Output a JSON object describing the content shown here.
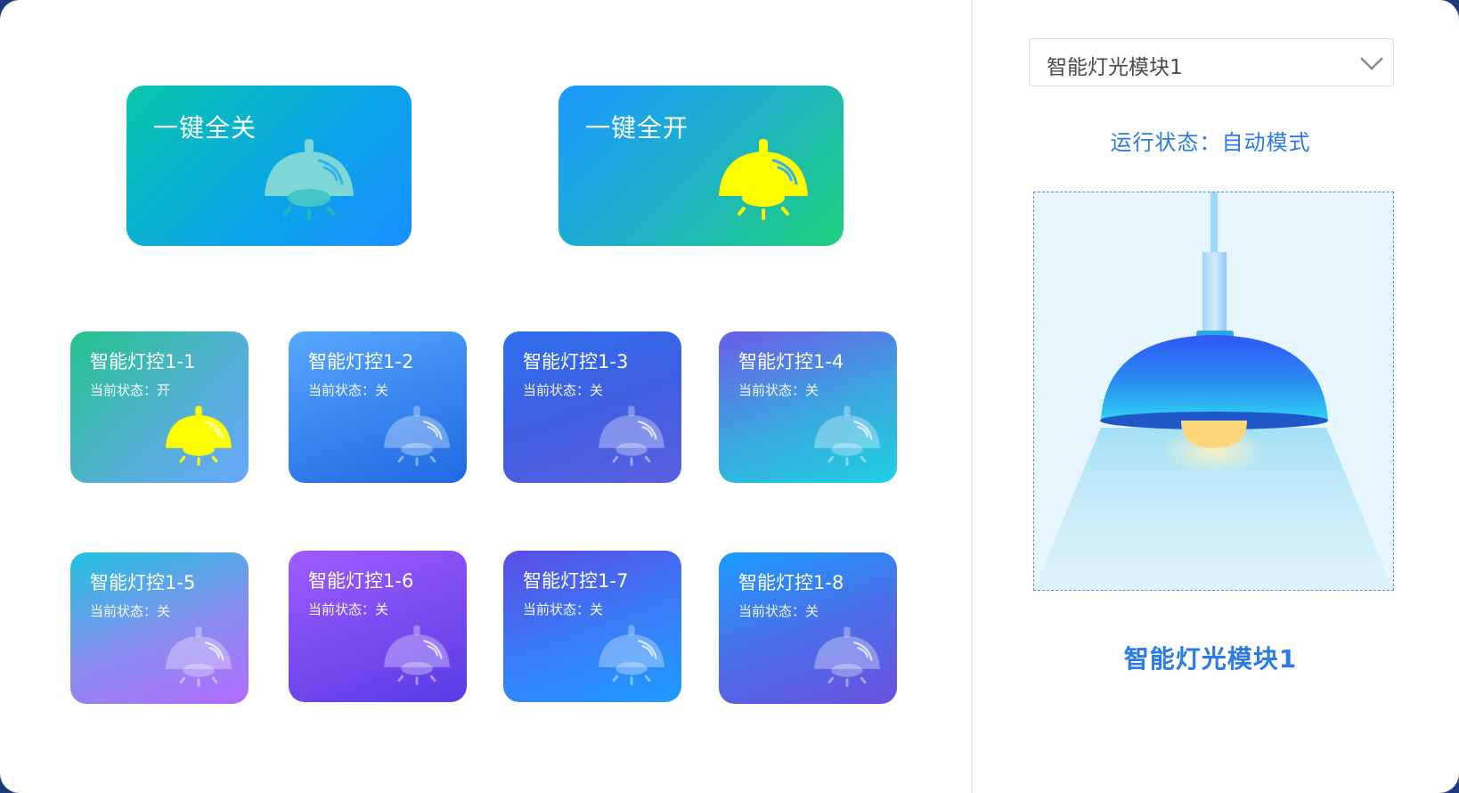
{
  "master": {
    "all_off": {
      "label": "一键全关",
      "state": "off"
    },
    "all_on": {
      "label": "一键全开",
      "state": "on"
    }
  },
  "lights": [
    {
      "name": "智能灯控1-1",
      "status": "当前状态：开",
      "on": true
    },
    {
      "name": "智能灯控1-2",
      "status": "当前状态：关",
      "on": false
    },
    {
      "name": "智能灯控1-3",
      "status": "当前状态：关",
      "on": false
    },
    {
      "name": "智能灯控1-4",
      "status": "当前状态：关",
      "on": false
    },
    {
      "name": "智能灯控1-5",
      "status": "当前状态：关",
      "on": false
    },
    {
      "name": "智能灯控1-6",
      "status": "当前状态：关",
      "on": false
    },
    {
      "name": "智能灯控1-7",
      "status": "当前状态：关",
      "on": false
    },
    {
      "name": "智能灯控1-8",
      "status": "当前状态：关",
      "on": false
    }
  ],
  "module_select": {
    "value": "智能灯光模块1",
    "icon": "chevron-down-icon"
  },
  "run_status": "运行状态：自动模式",
  "module_label": "智能灯光模块1",
  "colors": {
    "bulb_on": "#ffff00",
    "bulb_off_master": "#7fd6d6",
    "accent": "#2a7ae8"
  }
}
